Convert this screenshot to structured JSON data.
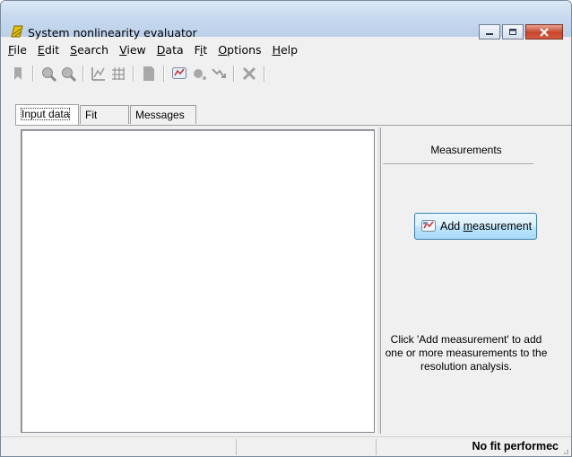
{
  "window": {
    "title": "System nonlinearity evaluator",
    "app_icon": "app-logo-icon",
    "controls": [
      "minimize-icon",
      "maximize-icon",
      "close-icon"
    ]
  },
  "menu": [
    "File",
    "Edit",
    "Search",
    "View",
    "Data",
    "Fit",
    "Options",
    "Help"
  ],
  "menu_mnemonics": [
    "F",
    "E",
    "S",
    "V",
    "D",
    "i",
    "O",
    "H"
  ],
  "toolbar": {
    "icons": [
      "bookmark-icon",
      "zoom-in-icon",
      "zoom-out-icon",
      "fit-view-icon",
      "grid-icon",
      "page-icon",
      "add-measurement-icon",
      "point-icon",
      "trend-icon",
      "delete-icon"
    ]
  },
  "tabs": [
    "Input data",
    "Fit",
    "Messages"
  ],
  "active_tab": "Input data",
  "measurements_panel": {
    "title": "Measurements",
    "add_button_prefix": "Add ",
    "add_button_mnemonic": "m",
    "add_button_suffix": "easurement",
    "help_line1": "Click 'Add measurement' to add",
    "help_line2": "one or more measurements to the",
    "help_line3": "resolution analysis."
  },
  "status": {
    "text": "No fit performec"
  },
  "colors": {
    "title_gradient_top": "#dbe8f6",
    "close_button": "#c8452b",
    "app_icon": "#e0b800",
    "button_border": "#3c7fb1"
  }
}
